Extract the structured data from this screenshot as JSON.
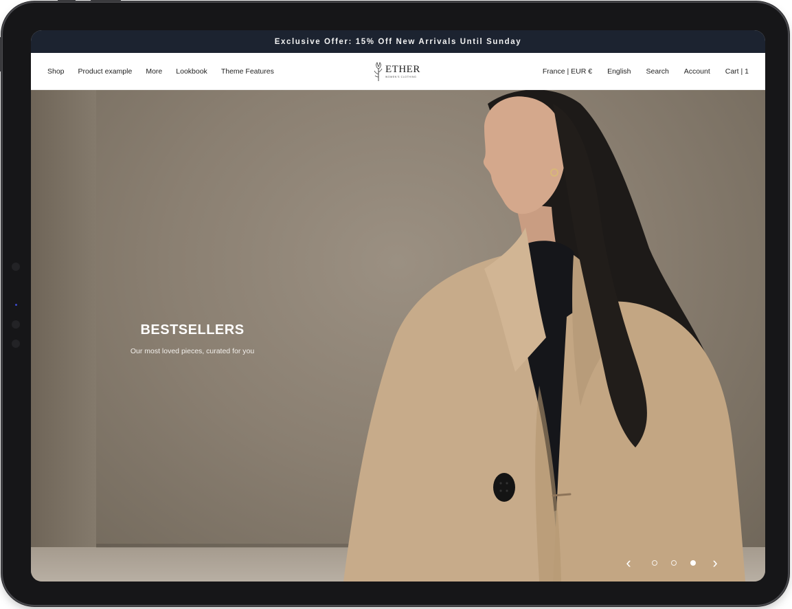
{
  "announcement": {
    "text": "Exclusive Offer: 15% Off New Arrivals Until Sunday"
  },
  "nav": {
    "left_items": [
      "Shop",
      "Product example",
      "More",
      "Lookbook",
      "Theme Features"
    ],
    "right_items": [
      "France | EUR €",
      "English",
      "Search",
      "Account",
      "Cart | 1"
    ]
  },
  "logo": {
    "word": "ETHER",
    "subtitle": "WOMEN'S CLOTHING",
    "icon": "flower-icon"
  },
  "hero": {
    "title": "BESTSELLERS",
    "subtitle": "Our most loved pieces, curated for you",
    "slides_total": 3,
    "active_slide": 3,
    "prev_icon": "chevron-left-icon",
    "next_icon": "chevron-right-icon"
  },
  "colors": {
    "announcement_bg": "#1c2330",
    "coat": "#c7ab8a",
    "wall": "#8a7f71"
  }
}
